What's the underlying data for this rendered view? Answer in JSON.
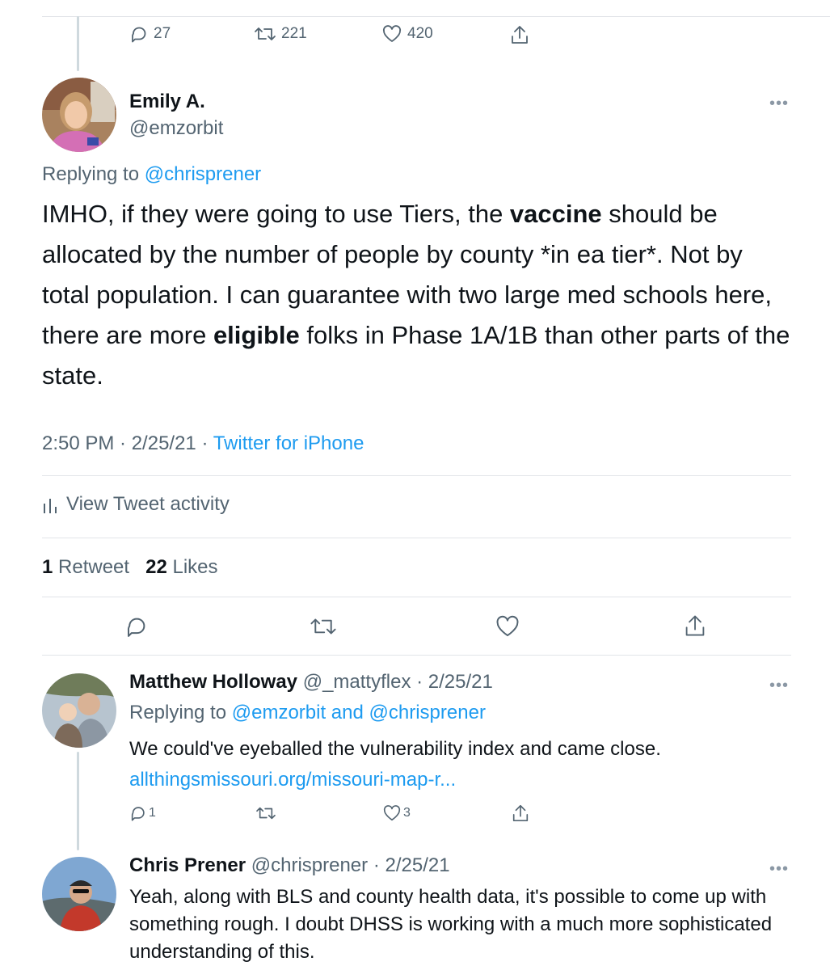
{
  "top_actions": {
    "replies": "27",
    "retweets": "221",
    "likes": "420"
  },
  "main_tweet": {
    "author_name": "Emily A.",
    "author_handle": "@emzorbit",
    "replying_label": "Replying to",
    "replying_to": "@chrisprener",
    "body": {
      "p1": "IMHO, if they were going to use Tiers, the ",
      "bold1": "vaccine",
      "p2": " should be allocated by the number of people by county *in ea tier*. Not by total population. I can guarantee with two large med schools here, there are more ",
      "bold2": "eligible",
      "p3": " folks in Phase 1A/1B than other parts of the state."
    },
    "timestamp": "2:50 PM · 2/25/21 · ",
    "source": "Twitter for iPhone",
    "activity_label": "View Tweet activity",
    "retweet_count": "1",
    "retweet_label": "Retweet",
    "like_count": "22",
    "like_label": "Likes"
  },
  "replies": [
    {
      "name": "Matthew Holloway",
      "handle": "@_mattyflex",
      "date": "· 2/25/21",
      "replying_label": "Replying to",
      "replying_to": "@emzorbit and @chrisprener",
      "text": "We could've eyeballed the vulnerability index and came close.",
      "link": "allthingsmissouri.org/missouri-map-r...",
      "reply_count": "1",
      "like_count": "3"
    },
    {
      "name": "Chris Prener",
      "handle": "@chrisprener",
      "date": "· 2/25/21",
      "text": "Yeah, along with BLS and county health data, it's possible to come up with something rough. I doubt DHSS is working with a much more sophisticated understanding of this."
    }
  ],
  "icons": {
    "reply": "reply-icon",
    "retweet": "retweet-icon",
    "like": "heart-icon",
    "share": "share-icon",
    "more": "more-icon",
    "activity": "bar-chart-icon"
  },
  "colors": {
    "link": "#1d9bf0",
    "muted": "#536471",
    "divider": "#e1e4e8"
  },
  "more_glyph": "•••"
}
